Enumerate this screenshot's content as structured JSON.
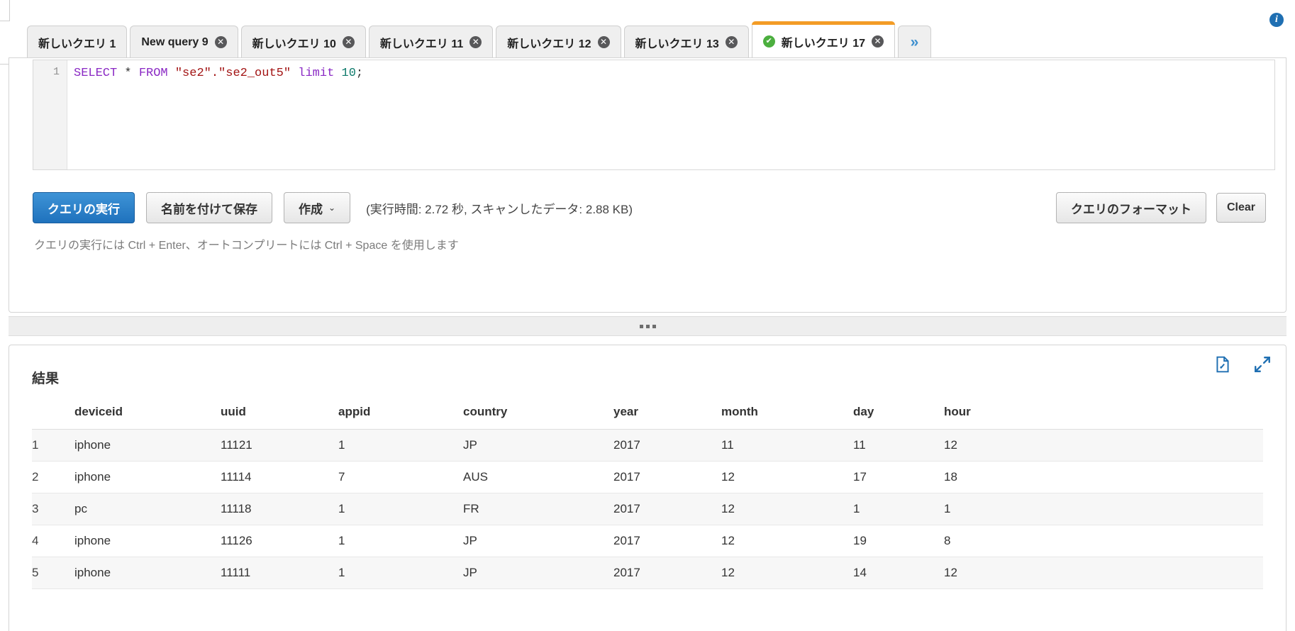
{
  "window": {
    "info_icon": "i"
  },
  "tabs": {
    "items": [
      {
        "label": "新しいクエリ 1",
        "closable": false,
        "active": false,
        "checked": false
      },
      {
        "label": "New query 9",
        "closable": true,
        "active": false,
        "checked": false
      },
      {
        "label": "新しいクエリ 10",
        "closable": true,
        "active": false,
        "checked": false
      },
      {
        "label": "新しいクエリ 11",
        "closable": true,
        "active": false,
        "checked": false
      },
      {
        "label": "新しいクエリ 12",
        "closable": true,
        "active": false,
        "checked": false
      },
      {
        "label": "新しいクエリ 13",
        "closable": true,
        "active": false,
        "checked": false
      },
      {
        "label": "新しいクエリ 17",
        "closable": true,
        "active": true,
        "checked": true
      }
    ],
    "overflow_label": "»",
    "close_glyph": "✕",
    "check_glyph": "✔",
    "active_accent_color": "#f39c26",
    "check_color": "#4caf3f"
  },
  "editor": {
    "line_number": "1",
    "sql": {
      "tok1": "SELECT",
      "tok2": " * ",
      "tok3": "FROM",
      "tok4": " ",
      "tok5": "\"se2\".\"se2_out5\"",
      "tok6": " ",
      "tok7": "limit",
      "tok8": " ",
      "tok9": "10",
      "tok10": ";"
    }
  },
  "toolbar": {
    "run_label": "クエリの実行",
    "save_as_label": "名前を付けて保存",
    "create_label": "作成",
    "create_caret": "⌄",
    "stats": "(実行時間: 2.72 秒, スキャンしたデータ: 2.88 KB)",
    "format_label": "クエリのフォーマット",
    "clear_label": "Clear",
    "hint": "クエリの実行には Ctrl + Enter、オートコンプリートには Ctrl + Space を使用します"
  },
  "results": {
    "title": "結果",
    "download_icon": "download-file-icon",
    "expand_icon": "expand-icon",
    "columns": [
      "",
      "deviceid",
      "uuid",
      "appid",
      "country",
      "year",
      "month",
      "day",
      "hour"
    ],
    "rows": [
      {
        "idx": "1",
        "deviceid": "iphone",
        "uuid": "11121",
        "appid": "1",
        "country": "JP",
        "year": "2017",
        "month": "11",
        "day": "11",
        "hour": "12"
      },
      {
        "idx": "2",
        "deviceid": "iphone",
        "uuid": "11114",
        "appid": "7",
        "country": "AUS",
        "year": "2017",
        "month": "12",
        "day": "17",
        "hour": "18"
      },
      {
        "idx": "3",
        "deviceid": "pc",
        "uuid": "11118",
        "appid": "1",
        "country": "FR",
        "year": "2017",
        "month": "12",
        "day": "1",
        "hour": "1"
      },
      {
        "idx": "4",
        "deviceid": "iphone",
        "uuid": "11126",
        "appid": "1",
        "country": "JP",
        "year": "2017",
        "month": "12",
        "day": "19",
        "hour": "8"
      },
      {
        "idx": "5",
        "deviceid": "iphone",
        "uuid": "11111",
        "appid": "1",
        "country": "JP",
        "year": "2017",
        "month": "12",
        "day": "14",
        "hour": "12"
      }
    ]
  }
}
